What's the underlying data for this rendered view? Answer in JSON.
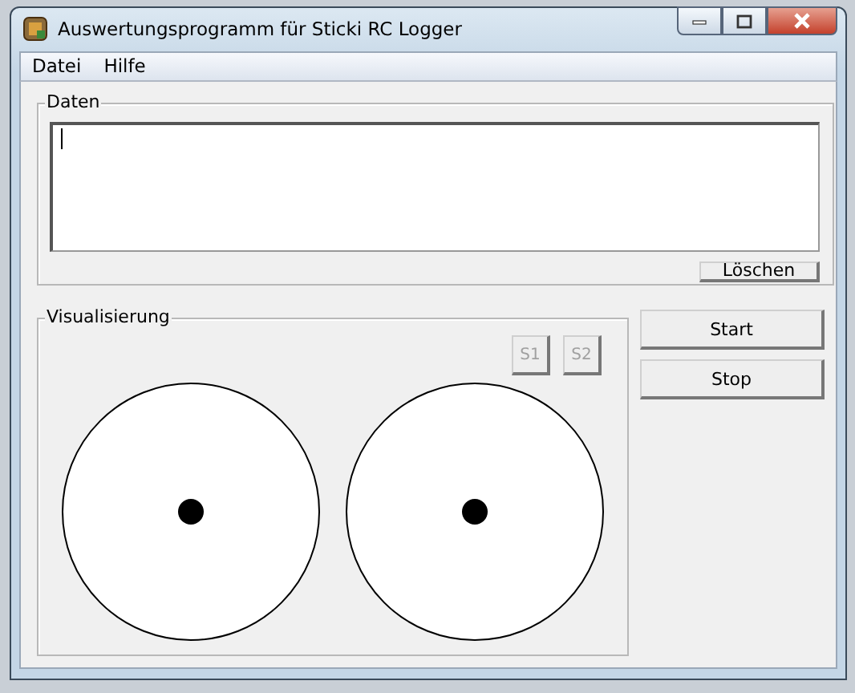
{
  "window": {
    "title": "Auswertungsprogramm für Sticki RC Logger"
  },
  "menu": [
    {
      "label": "Datei"
    },
    {
      "label": "Hilfe"
    }
  ],
  "daten": {
    "title": "Daten",
    "clear_button": "Löschen"
  },
  "visualisierung": {
    "title": "Visualisierung",
    "buttons": [
      {
        "label": "S1",
        "disabled": true
      },
      {
        "label": "S2",
        "disabled": true
      }
    ]
  },
  "actions": [
    {
      "label": "Start"
    },
    {
      "label": "Stop"
    }
  ]
}
